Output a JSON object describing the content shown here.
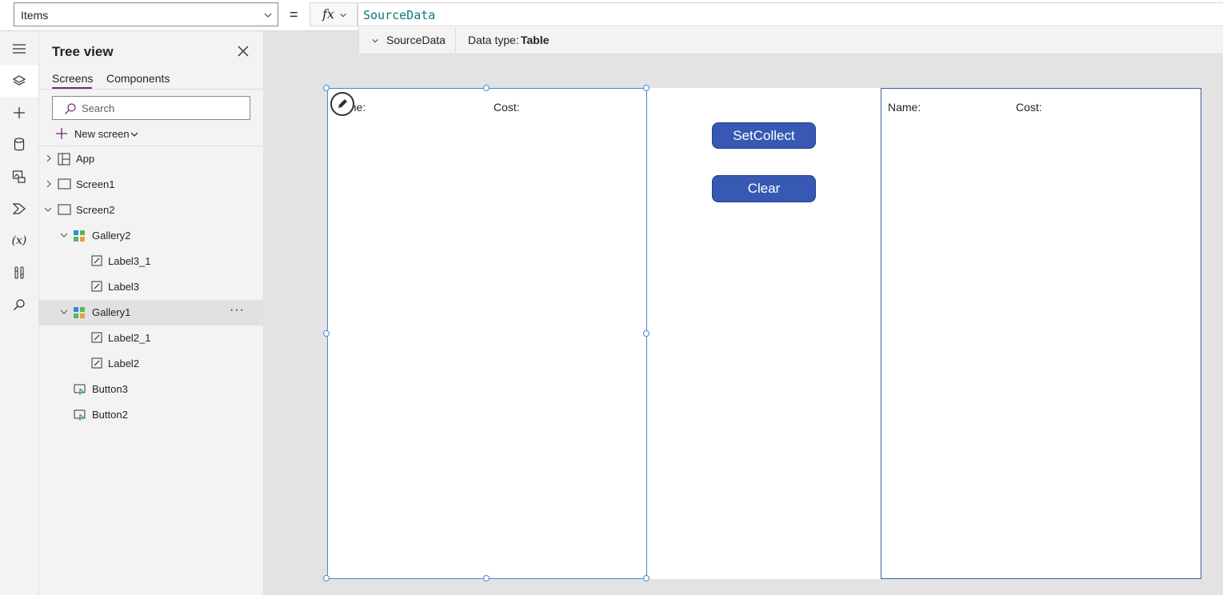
{
  "formula_bar": {
    "property": "Items",
    "equals": "=",
    "fx": "fx",
    "formula": "SourceData",
    "result_name": "SourceData",
    "data_type_label": "Data type:",
    "data_type_value": "Table"
  },
  "rail": {
    "icons": [
      "hamburger-icon",
      "layers-icon",
      "plus-icon",
      "database-icon",
      "media-icon",
      "power-automate-icon",
      "variables-icon",
      "tools-icon",
      "search-icon"
    ],
    "variables_glyph": "(x)"
  },
  "tree": {
    "title": "Tree view",
    "tabs": [
      "Screens",
      "Components"
    ],
    "search_placeholder": "Search",
    "new_screen": "New screen",
    "nodes": [
      {
        "label": "App",
        "icon": "app-icon"
      },
      {
        "label": "Screen1",
        "icon": "screen-icon"
      },
      {
        "label": "Screen2",
        "icon": "screen-icon"
      },
      {
        "label": "Gallery2",
        "icon": "gallery-icon"
      },
      {
        "label": "Label3_1",
        "icon": "label-icon"
      },
      {
        "label": "Label3",
        "icon": "label-icon"
      },
      {
        "label": "Gallery1",
        "icon": "gallery-icon",
        "more": "···"
      },
      {
        "label": "Label2_1",
        "icon": "label-icon"
      },
      {
        "label": "Label2",
        "icon": "label-icon"
      },
      {
        "label": "Button3",
        "icon": "button-icon"
      },
      {
        "label": "Button2",
        "icon": "button-icon"
      }
    ]
  },
  "canvas": {
    "gallery1": {
      "name_label": "Name:",
      "cost_label": "Cost:"
    },
    "gallery2": {
      "name_label": "Name:",
      "cost_label": "Cost:"
    },
    "buttons": {
      "setcollect": "SetCollect",
      "clear": "Clear"
    }
  },
  "colors": {
    "accent": "#742774",
    "button_fill": "#3759b3",
    "selection": "#3f8ad6",
    "formula_text": "#0b7a75"
  }
}
